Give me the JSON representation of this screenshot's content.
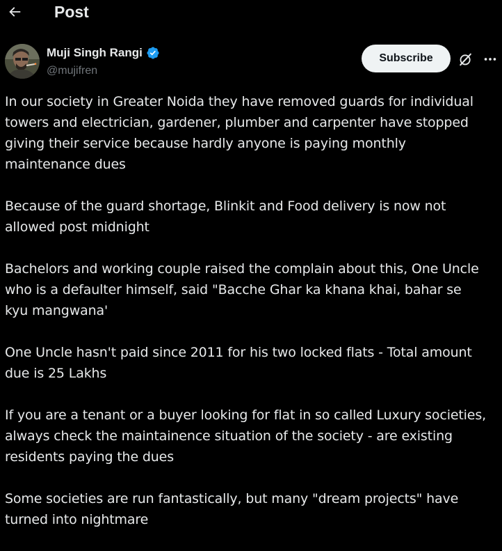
{
  "header": {
    "title": "Post",
    "back_icon": "arrow-left-icon"
  },
  "author": {
    "name": "Muji Singh Rangi",
    "handle": "@mujifren",
    "verified": true,
    "verified_color": "#1d9bf0"
  },
  "actions": {
    "subscribe_label": "Subscribe",
    "grok_icon": "grok-icon",
    "more_icon": "more-icon"
  },
  "post": {
    "paragraphs": [
      "In our society in Greater Noida they have removed guards for individual\ntowers and electrician, gardener, plumber and carpenter have stopped\ngiving their service because hardly anyone is paying monthly\nmaintenance dues",
      "Because of the guard shortage, Blinkit and Food delivery is now not\nallowed post midnight",
      "Bachelors and working couple raised the complain about this, One Uncle\nwho is a defaulter himself, said \"Bacche Ghar ka khana khai, bahar se\nkyu mangwana'",
      "One Uncle hasn't paid since 2011 for his two locked flats - Total amount\ndue is 25 Lakhs",
      "If you are a tenant or a buyer looking for flat in so called Luxury societies,\nalways check the maintainence situation of the society - are existing\nresidents paying the dues",
      "Some societies are run fantastically, but many \"dream projects\" have\nturned into nightmare"
    ]
  },
  "colors": {
    "background": "#000000",
    "text_primary": "#e7e9ea",
    "text_secondary": "#71767b",
    "button_bg": "#eff3f4",
    "button_text": "#0f1419"
  }
}
